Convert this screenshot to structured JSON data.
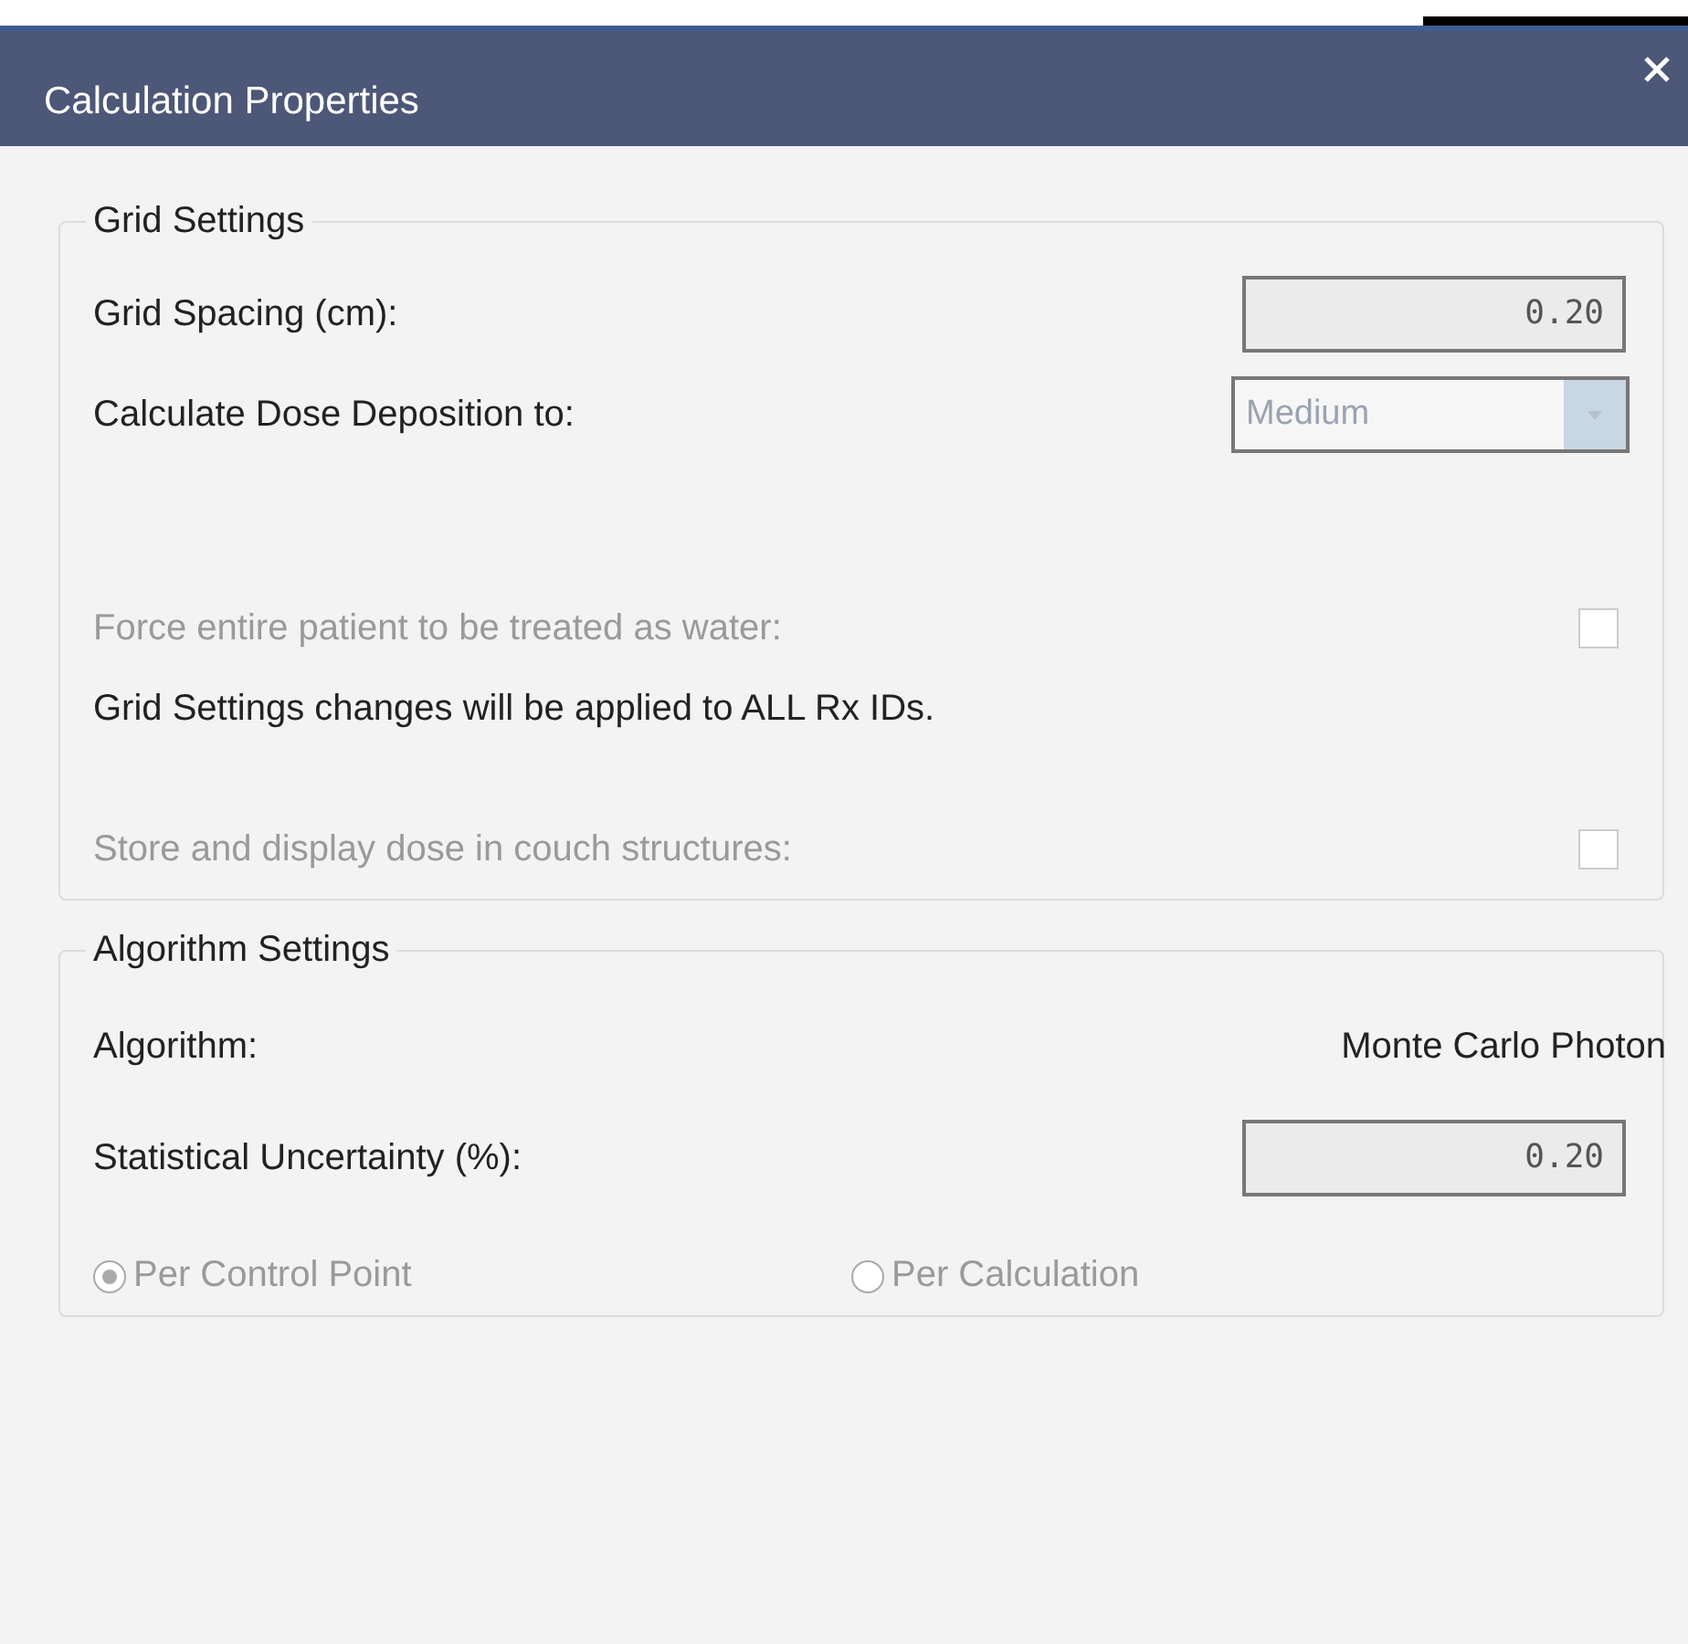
{
  "window": {
    "title": "Calculation Properties"
  },
  "groups": [
    {
      "title": "Grid Settings",
      "rows": [
        {
          "kind": "input",
          "label": "Grid Spacing (cm):",
          "value": "0.20",
          "disabled": false
        },
        {
          "kind": "dropdown",
          "label": "Calculate Dose Deposition to:",
          "value": "Medium",
          "disabled": false
        },
        {
          "kind": "checkbox",
          "label": "Force entire patient to be treated as water:",
          "checked": false,
          "disabled": true
        },
        {
          "kind": "note",
          "label": "Grid Settings changes will be applied to ALL Rx IDs."
        },
        {
          "kind": "checkbox",
          "label": "Store and display dose in couch structures:",
          "checked": false,
          "disabled": true
        }
      ]
    },
    {
      "title": "Algorithm Settings",
      "rows": [
        {
          "kind": "value",
          "label": "Algorithm:",
          "value": "Monte Carlo Photon",
          "disabled": false
        },
        {
          "kind": "input",
          "label": "Statistical Uncertainty (%):",
          "value": "0.20",
          "disabled": false
        },
        {
          "kind": "radios",
          "options": [
            {
              "label": "Per Control Point",
              "selected": true,
              "disabled": true
            },
            {
              "label": "Per Calculation",
              "selected": false,
              "disabled": true
            }
          ]
        }
      ]
    }
  ]
}
